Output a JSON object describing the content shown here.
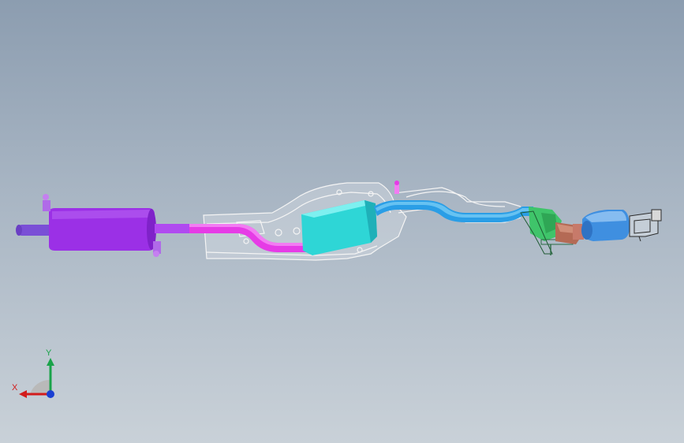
{
  "viewport": {
    "name": "cad-graphics-area",
    "background_top": "#8c9db0",
    "background_bottom": "#c9d1d8"
  },
  "model": {
    "name": "exhaust-system-assembly",
    "colors": {
      "rear_muffler": "#9b30e6",
      "tailpipe": "#7a4fd6",
      "rear_pipe": "#e63be6",
      "center_muffler": "#2ed6d6",
      "front_pipe": "#2a9ee6",
      "catalytic_converter": "#3f8fe0",
      "manifold_flange": "#b46a55",
      "brackets": "#3fc46a",
      "heat_shield": "#f2f2f2"
    }
  },
  "triad": {
    "y_label": "Y",
    "x_label": "X",
    "colors": {
      "x": "#d21b1b",
      "y": "#1aa34a",
      "z": "#1a3fd2"
    }
  }
}
